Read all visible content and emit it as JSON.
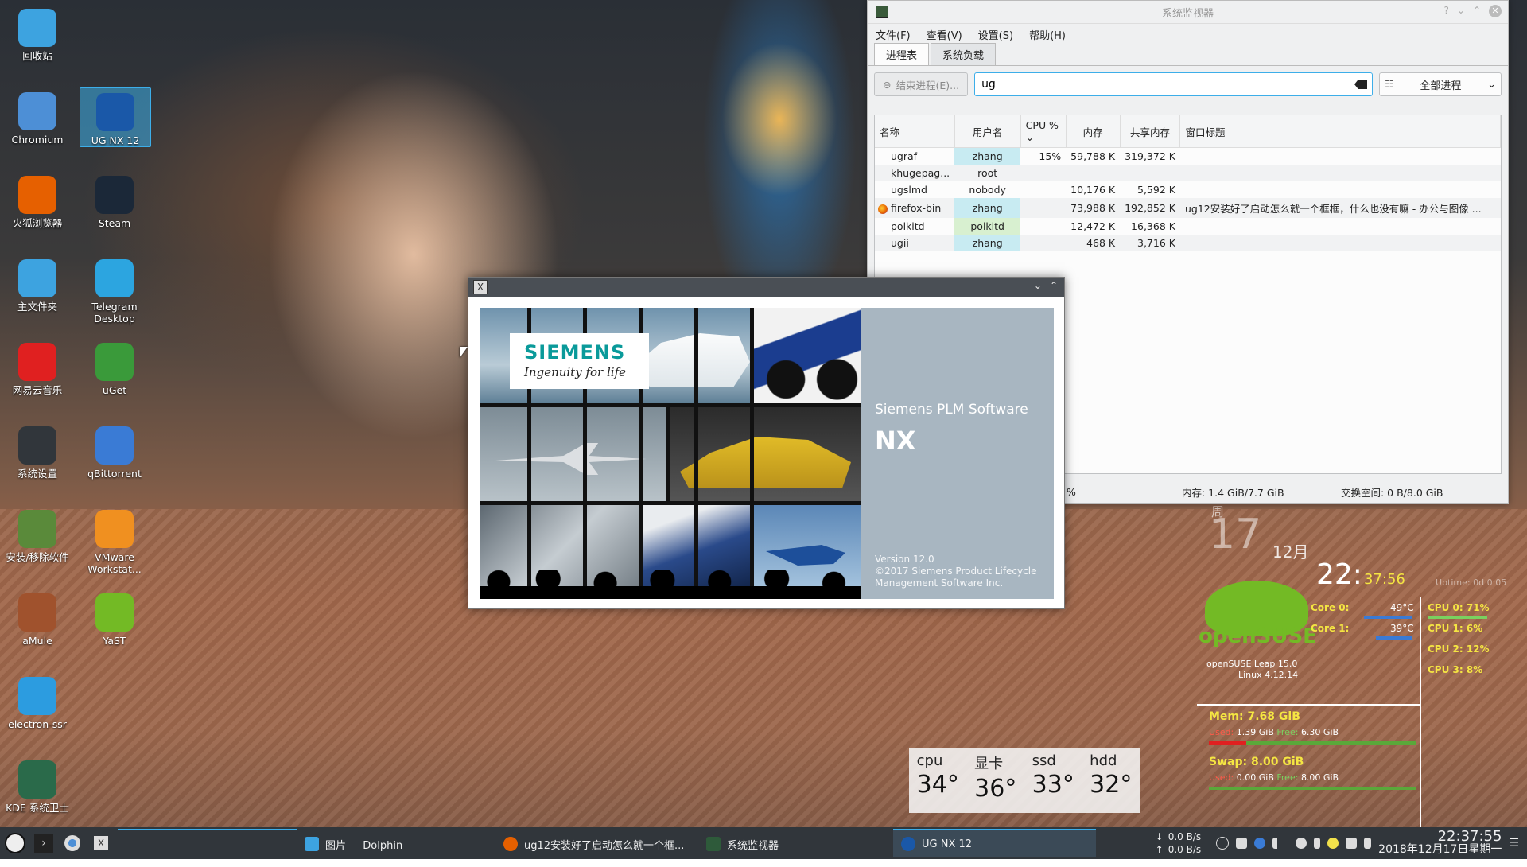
{
  "desktop_icons": [
    {
      "label": "回收站",
      "icon": "trash-icon",
      "color": "#3da3e0"
    },
    {
      "label": "Chromium",
      "icon": "chromium-icon",
      "color": "#4d8fd6"
    },
    {
      "label": "UG NX 12",
      "icon": "ugnx-icon",
      "color": "#1a58a8"
    },
    {
      "label": "火狐浏览器",
      "icon": "firefox-icon",
      "color": "#e66000"
    },
    {
      "label": "Steam",
      "icon": "steam-icon",
      "color": "#1b2838"
    },
    {
      "label": "主文件夹",
      "icon": "home-folder-icon",
      "color": "#3da3e0"
    },
    {
      "label": "Telegram Desktop",
      "icon": "telegram-icon",
      "color": "#2ca5e0"
    },
    {
      "label": "网易云音乐",
      "icon": "netease-music-icon",
      "color": "#e02020"
    },
    {
      "label": "uGet",
      "icon": "uget-icon",
      "color": "#3a9a3a"
    },
    {
      "label": "系统设置",
      "icon": "settings-icon",
      "color": "#31363b"
    },
    {
      "label": "qBittorrent",
      "icon": "qbittorrent-icon",
      "color": "#3a7bd5"
    },
    {
      "label": "安装/移除软件",
      "icon": "package-manager-icon",
      "color": "#5a8a3a"
    },
    {
      "label": "VMware Workstat...",
      "icon": "vmware-icon",
      "color": "#f09020"
    },
    {
      "label": "aMule",
      "icon": "amule-icon",
      "color": "#a0522d"
    },
    {
      "label": "YaST",
      "icon": "yast-icon",
      "color": "#73ba25"
    },
    {
      "label": "electron-ssr",
      "icon": "electron-ssr-icon",
      "color": "#2c9ce0"
    },
    {
      "label": "KDE 系统卫士",
      "icon": "kde-sysguard-icon",
      "color": "#2a6a4a"
    }
  ],
  "sysmon": {
    "title": "系统监视器",
    "menu": [
      "文件(F)",
      "查看(V)",
      "设置(S)",
      "帮助(H)"
    ],
    "tabs": [
      "进程表",
      "系统负载"
    ],
    "end_process_label": "结束进程(E)...",
    "search_value": "ug",
    "filter_label": "全部进程",
    "columns": [
      "名称",
      "用户名",
      "CPU %",
      "内存",
      "共享内存",
      "窗口标题"
    ],
    "rows": [
      {
        "name": "ugraf",
        "user": "zhang",
        "cpu": "15%",
        "mem": "59,788 K",
        "shared": "319,372 K",
        "title": ""
      },
      {
        "name": "khugepag...",
        "user": "root",
        "cpu": "",
        "mem": "",
        "shared": "",
        "title": ""
      },
      {
        "name": "ugslmd",
        "user": "nobody",
        "cpu": "",
        "mem": "10,176 K",
        "shared": "5,592 K",
        "title": ""
      },
      {
        "name": "firefox-bin",
        "user": "zhang",
        "cpu": "",
        "mem": "73,988 K",
        "shared": "192,852 K",
        "title": "ug12安装好了启动怎么就一个框框，什么也没有嘛 - 办公与图像 ..."
      },
      {
        "name": "polkitd",
        "user": "polkitd",
        "cpu": "",
        "mem": "12,472 K",
        "shared": "16,368 K",
        "title": ""
      },
      {
        "name": "ugii",
        "user": "zhang",
        "cpu": "",
        "mem": "468 K",
        "shared": "3,716 K",
        "title": ""
      }
    ],
    "status_cpu": "%",
    "status_mem": "内存: 1.4 GiB/7.7 GiB",
    "status_swap": "交换空间:  0 B/8.0 GiB"
  },
  "nx_splash": {
    "siemens": "SIEMENS",
    "tagline": "Ingenuity for life",
    "brand": "Siemens PLM Software",
    "product": "NX",
    "legal": [
      "Version 12.0",
      "©2017 Siemens Product Lifecycle",
      "Management Software Inc."
    ]
  },
  "temps": [
    {
      "label": "cpu",
      "value": "34°"
    },
    {
      "label": "显卡",
      "value": "36°"
    },
    {
      "label": "ssd",
      "value": "33°"
    },
    {
      "label": "hdd",
      "value": "32°"
    }
  ],
  "conky": {
    "weekday": "周",
    "day": "17",
    "month": "12月",
    "time_hm": "22:",
    "time_s": "37:56",
    "uptime": "Uptime: 0d 0:05",
    "core0": "Core 0:",
    "core0_temp": "49°C",
    "core1": "Core 1:",
    "core1_temp": "39°C",
    "cpu_rows": [
      "CPU 0: 71%",
      "CPU 1: 6%",
      "CPU 2: 12%",
      "CPU 3: 8%"
    ],
    "distro": "openSUSE Leap 15.0",
    "kernel": "Linux 4.12.14",
    "logo_text": "openSUSE",
    "mem_title": "Mem: 7.68 GiB",
    "mem_used_label": "Used:",
    "mem_used": "1.39 GiB",
    "mem_free_label": "Free:",
    "mem_free": "6.30 GiB",
    "swap_title": "Swap: 8.00 GiB",
    "swap_used_label": "Used:",
    "swap_used": "0.00 GiB",
    "swap_free_label": "Free:",
    "swap_free": "8.00 GiB"
  },
  "taskbar": {
    "tasks": [
      {
        "label": "图片 — Dolphin",
        "icon": "dolphin-icon",
        "color": "#3da3e0"
      },
      {
        "label": "ug12安装好了启动怎么就一个框...",
        "icon": "firefox-icon",
        "color": "#e66000"
      },
      {
        "label": "系统监视器",
        "icon": "sysmon-icon",
        "color": "#2e5a3a"
      },
      {
        "label": "UG NX 12",
        "icon": "ugnx-icon",
        "color": "#1a58a8"
      }
    ],
    "net_down": "0.0 B/s",
    "net_up": "0.0 B/s",
    "time": "22:37:55",
    "date": "2018年12月17日星期一"
  }
}
